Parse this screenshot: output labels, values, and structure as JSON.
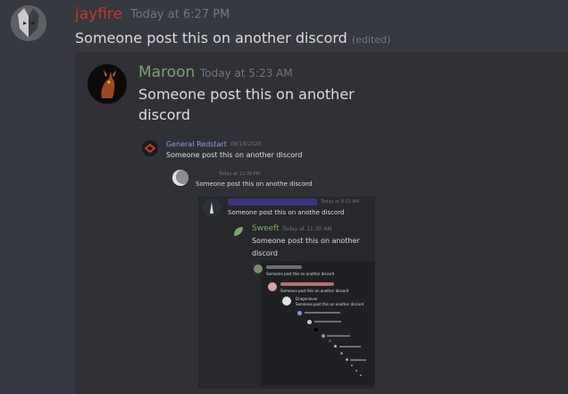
{
  "messages": [
    {
      "author": "jayfire",
      "author_color": "#c5372f",
      "timestamp": "Today at 6:27 PM",
      "content": "Someone post this on another discord",
      "edited": "(edited)"
    },
    {
      "author": "Maroon",
      "author_color": "#7fa071",
      "timestamp": "Today at 5:23 AM",
      "content_line1": "Someone post this on another",
      "content_line2": "discord"
    },
    {
      "author": "General Redstart",
      "author_color": "#8e9be8",
      "timestamp": "08/18/2020",
      "content": "Someone post this on another discord"
    },
    {
      "author": "",
      "timestamp": "Today at 12:39 PM",
      "content": "Someone post this on anothe discord"
    },
    {
      "author": "",
      "timestamp": "Today at 8:32 AM",
      "content": "Someone post this on anothe discord"
    },
    {
      "author": "Sweeft",
      "author_color": "#7ba86c",
      "timestamp": "Today at 11:30 AM",
      "content_line1": "Someone post this on another",
      "content_line2": "discord"
    },
    {
      "author": "",
      "content": "Someone post this on another discord"
    },
    {
      "author": "",
      "content": "Someone post this on another discord"
    },
    {
      "author": "Dragonlover",
      "content": "Someone post this on another discord"
    }
  ],
  "colors": {
    "background": "#36393f",
    "embed": "#2f3136",
    "embed_inner": "#26282c",
    "timestamp": "#72767d"
  }
}
